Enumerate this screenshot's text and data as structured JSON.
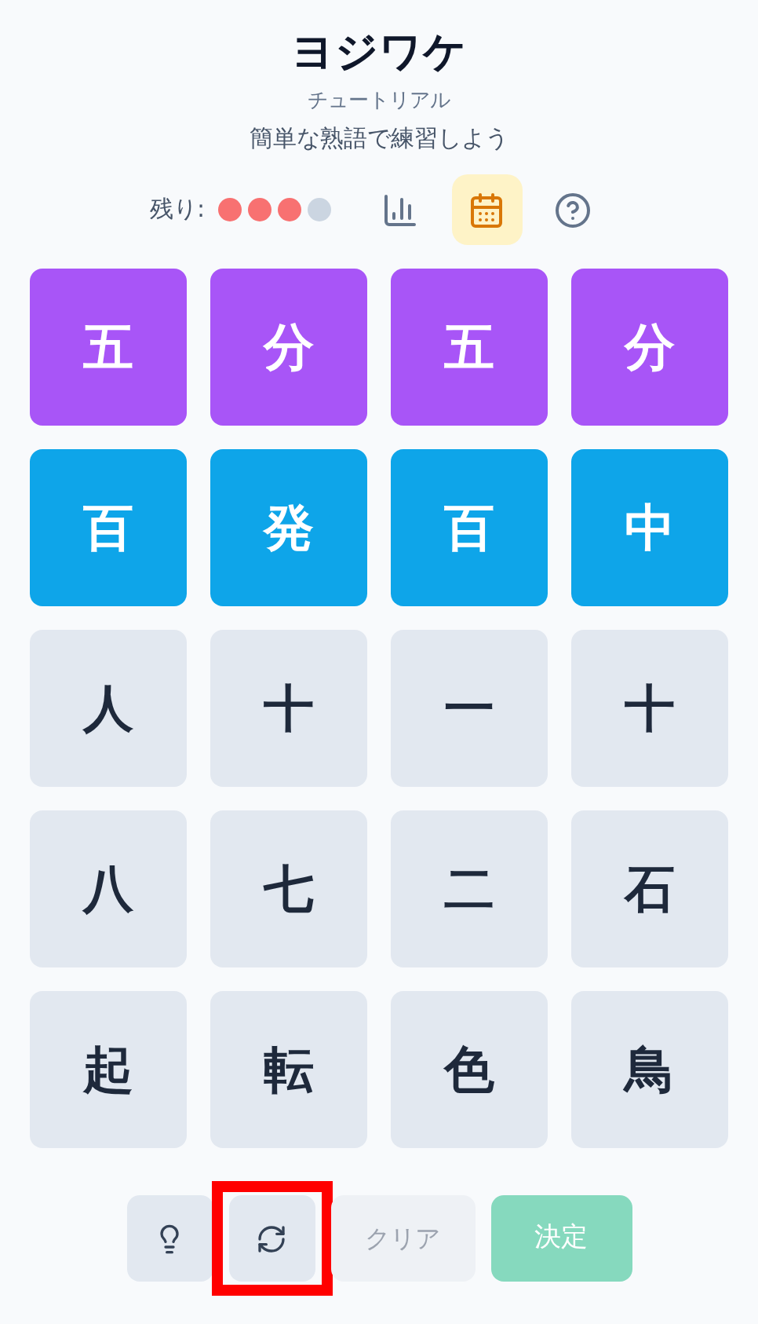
{
  "header": {
    "title": "ヨジワケ",
    "subtitle": "チュートリアル",
    "description": "簡単な熟語で練習しよう"
  },
  "status": {
    "lives_label": "残り:",
    "lives": [
      {
        "filled": true
      },
      {
        "filled": true
      },
      {
        "filled": true
      },
      {
        "filled": false
      }
    ],
    "tools": [
      {
        "kind": "stats",
        "selected": false
      },
      {
        "kind": "calendar",
        "selected": true
      },
      {
        "kind": "help",
        "selected": false
      }
    ]
  },
  "tiles": [
    {
      "char": "五",
      "color": "#a855f7"
    },
    {
      "char": "分",
      "color": "#a855f7"
    },
    {
      "char": "五",
      "color": "#a855f7"
    },
    {
      "char": "分",
      "color": "#a855f7"
    },
    {
      "char": "百",
      "color": "#0ea5e9"
    },
    {
      "char": "発",
      "color": "#0ea5e9"
    },
    {
      "char": "百",
      "color": "#0ea5e9"
    },
    {
      "char": "中",
      "color": "#0ea5e9"
    },
    {
      "char": "人"
    },
    {
      "char": "十"
    },
    {
      "char": "一"
    },
    {
      "char": "十"
    },
    {
      "char": "八"
    },
    {
      "char": "七"
    },
    {
      "char": "二"
    },
    {
      "char": "石"
    },
    {
      "char": "起"
    },
    {
      "char": "転"
    },
    {
      "char": "色"
    },
    {
      "char": "鳥"
    }
  ],
  "actions": [
    {
      "kind": "hint"
    },
    {
      "kind": "shuffle",
      "highlighted": true
    },
    {
      "kind": "clear",
      "label": "クリア",
      "disabled": true
    },
    {
      "kind": "submit",
      "label": "決定",
      "disabled": true
    }
  ]
}
